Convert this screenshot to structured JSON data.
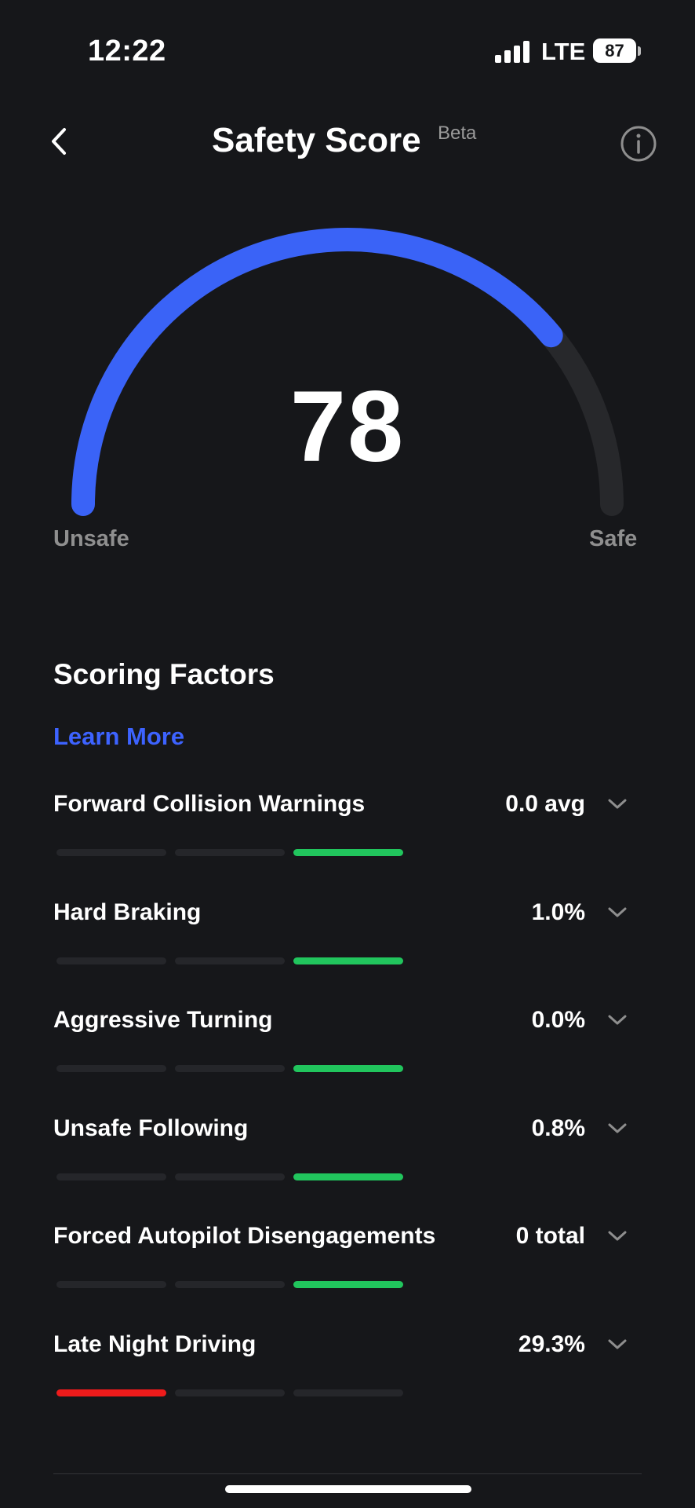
{
  "status_bar": {
    "time": "12:22",
    "network": "LTE",
    "battery": "87"
  },
  "header": {
    "title": "Safety Score",
    "badge": "Beta",
    "back_icon": "chevron-left-icon",
    "info_icon": "info-icon"
  },
  "gauge": {
    "score": "78",
    "score_value": 78,
    "score_max": 100,
    "min_label": "Unsafe",
    "max_label": "Safe",
    "fill_color": "#3a63f7",
    "track_color": "#27282b"
  },
  "factors_section": {
    "heading": "Scoring Factors",
    "learn_more": "Learn More",
    "items": [
      {
        "name": "Forward Collision Warnings",
        "value": "0.0 avg",
        "level": 3,
        "color": "#21c55d"
      },
      {
        "name": "Hard Braking",
        "value": "1.0%",
        "level": 3,
        "color": "#21c55d"
      },
      {
        "name": "Aggressive Turning",
        "value": "0.0%",
        "level": 3,
        "color": "#21c55d"
      },
      {
        "name": "Unsafe Following",
        "value": "0.8%",
        "level": 3,
        "color": "#21c55d"
      },
      {
        "name": "Forced Autopilot Disengagements",
        "value": "0 total",
        "level": 3,
        "color": "#21c55d"
      },
      {
        "name": "Late Night Driving",
        "value": "29.3%",
        "level": 1,
        "color": "#ee1b1b"
      }
    ]
  }
}
